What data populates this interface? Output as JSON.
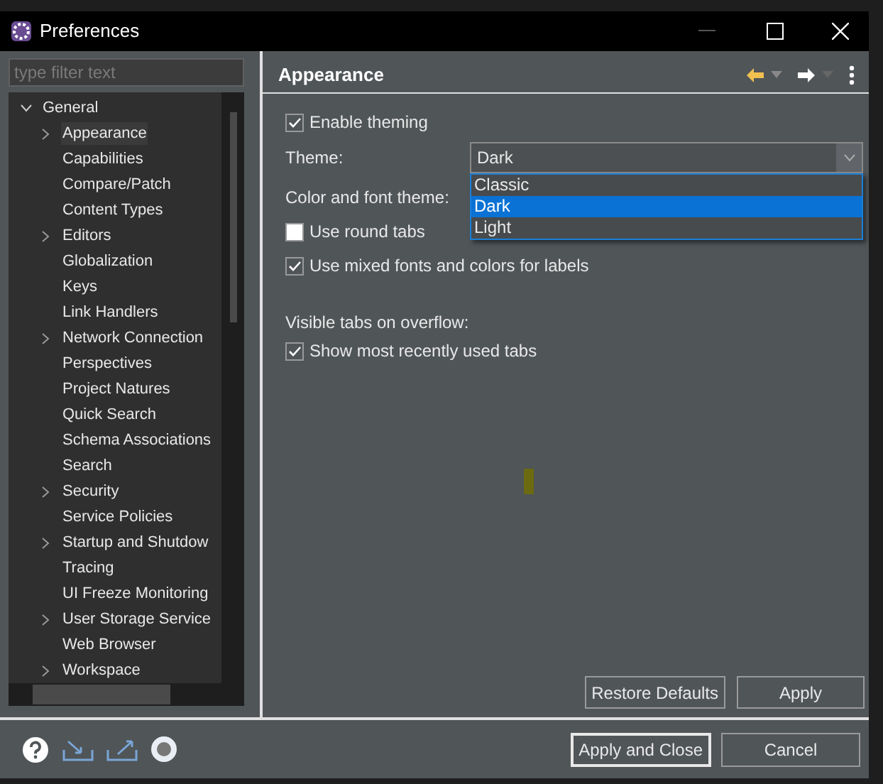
{
  "window": {
    "title": "Preferences"
  },
  "filter": {
    "placeholder": "type filter text"
  },
  "tree": [
    {
      "label": "General",
      "expanded": true,
      "children": [
        {
          "label": "Appearance",
          "selected": true,
          "expandable": true
        },
        {
          "label": "Capabilities",
          "selected": false,
          "expandable": false
        },
        {
          "label": "Compare/Patch",
          "selected": false,
          "expandable": false
        },
        {
          "label": "Content Types",
          "selected": false,
          "expandable": false
        },
        {
          "label": "Editors",
          "selected": false,
          "expandable": true
        },
        {
          "label": "Globalization",
          "selected": false,
          "expandable": false
        },
        {
          "label": "Keys",
          "selected": false,
          "expandable": false
        },
        {
          "label": "Link Handlers",
          "selected": false,
          "expandable": false
        },
        {
          "label": "Network Connection",
          "selected": false,
          "expandable": true
        },
        {
          "label": "Perspectives",
          "selected": false,
          "expandable": false
        },
        {
          "label": "Project Natures",
          "selected": false,
          "expandable": false
        },
        {
          "label": "Quick Search",
          "selected": false,
          "expandable": false
        },
        {
          "label": "Schema Associations",
          "selected": false,
          "expandable": false
        },
        {
          "label": "Search",
          "selected": false,
          "expandable": false
        },
        {
          "label": "Security",
          "selected": false,
          "expandable": true
        },
        {
          "label": "Service Policies",
          "selected": false,
          "expandable": false
        },
        {
          "label": "Startup and Shutdow",
          "selected": false,
          "expandable": true
        },
        {
          "label": "Tracing",
          "selected": false,
          "expandable": false
        },
        {
          "label": "UI Freeze Monitoring",
          "selected": false,
          "expandable": false
        },
        {
          "label": "User Storage Service",
          "selected": false,
          "expandable": true
        },
        {
          "label": "Web Browser",
          "selected": false,
          "expandable": false
        },
        {
          "label": "Workspace",
          "selected": false,
          "expandable": true
        }
      ]
    }
  ],
  "page": {
    "title": "Appearance",
    "enable_theming": {
      "label": "Enable theming",
      "checked": true
    },
    "theme": {
      "label": "Theme:",
      "value": "Dark",
      "options": [
        {
          "label": "Classic",
          "selected": false
        },
        {
          "label": "Dark",
          "selected": true
        },
        {
          "label": "Light",
          "selected": false
        }
      ]
    },
    "color_font_theme": {
      "label": "Color and font theme:"
    },
    "options": [
      {
        "label": "Use round tabs",
        "checked": false
      },
      {
        "label": "Use mixed fonts and colors for labels",
        "checked": true
      }
    ],
    "overflow": {
      "label": "Visible tabs on overflow:",
      "options": [
        {
          "label": "Show most recently used tabs",
          "checked": true
        }
      ]
    },
    "buttons": [
      "Restore Defaults",
      "Apply"
    ]
  },
  "footer_buttons": [
    {
      "label": "Apply and Close",
      "default": true
    },
    {
      "label": "Cancel",
      "default": false
    }
  ]
}
